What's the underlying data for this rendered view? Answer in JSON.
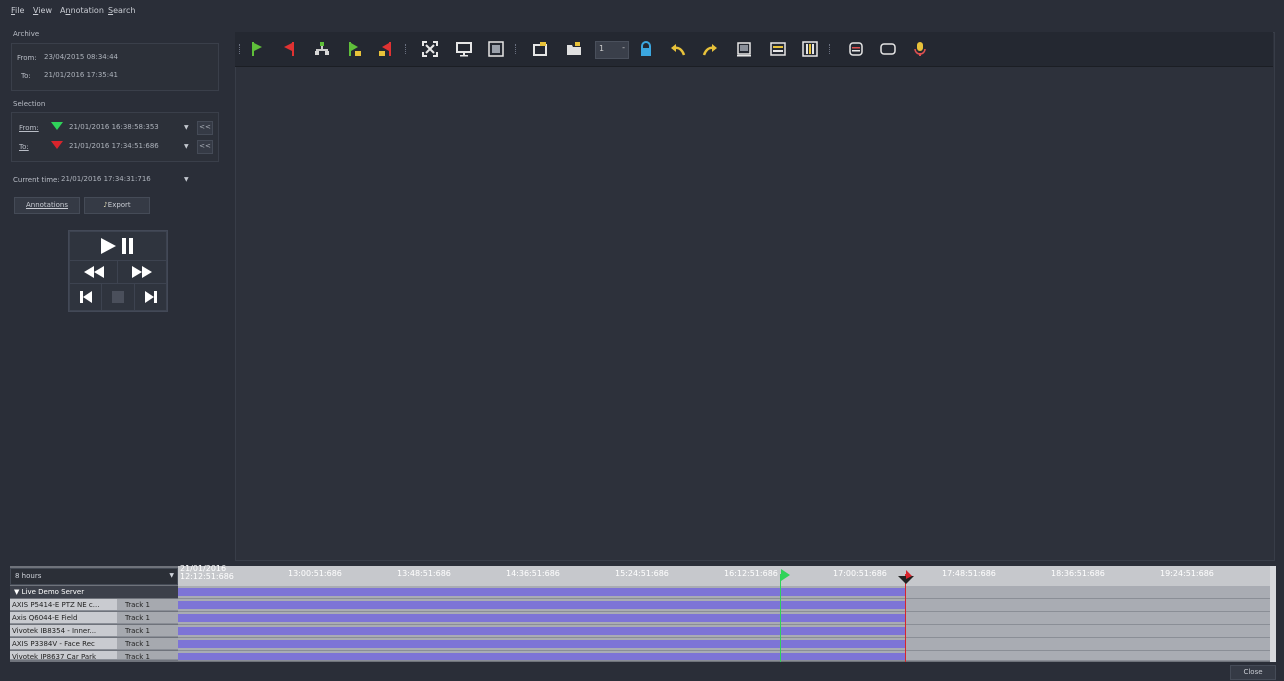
{
  "menu": [
    {
      "key": "file",
      "prefix": "",
      "u": "F",
      "rest": "ile"
    },
    {
      "key": "view",
      "prefix": "",
      "u": "V",
      "rest": "iew"
    },
    {
      "key": "annotation",
      "prefix": "A",
      "u": "n",
      "rest": "notation"
    },
    {
      "key": "search",
      "prefix": "",
      "u": "S",
      "rest": "earch"
    }
  ],
  "archive": {
    "title": "Archive",
    "from_label": "From:",
    "from_value": "23/04/2015 08:34:44",
    "to_label": "To:",
    "to_value": "21/01/2016 17:35:41"
  },
  "selection": {
    "title": "Selection",
    "from_label": "From:",
    "from_value": "21/01/2016 16:38:58:353",
    "to_label": "To:",
    "to_value": "21/01/2016 17:34:51:686",
    "jump_label": "<<"
  },
  "current_time": {
    "label": "Current time:",
    "value": "21/01/2016 17:34:31:716"
  },
  "buttons": {
    "annotations": "Annotations",
    "export": "Export",
    "close": "Close"
  },
  "toolbar": {
    "zoom_value": "1"
  },
  "timeline": {
    "range_select": "8 hours",
    "ticks": [
      "21/01/2016",
      "13:00:51:686",
      "13:48:51:686",
      "14:36:51:686",
      "15:24:51:686",
      "16:12:51:686",
      "17:00:51:686",
      "17:48:51:686",
      "18:36:51:686",
      "19:24:51:686"
    ],
    "first_tick_line2": "12:12:51:686",
    "server": "Live Demo Server",
    "tracks": [
      {
        "name": "AXIS P5414-E PTZ NE c...",
        "label": "Track 1"
      },
      {
        "name": "Axis Q6044-E Field",
        "label": "Track 1"
      },
      {
        "name": "Vivotek IB8354 - Inner...",
        "label": "Track 1"
      },
      {
        "name": "AXIS P3384V - Face Rec",
        "label": "Track 1"
      },
      {
        "name": "Vivotek IP8637 Car Park",
        "label": "Track 1"
      }
    ],
    "colors": {
      "recording": "#7d74d6",
      "selection_start": "#2fd35a",
      "selection_end": "#d8242c"
    }
  }
}
